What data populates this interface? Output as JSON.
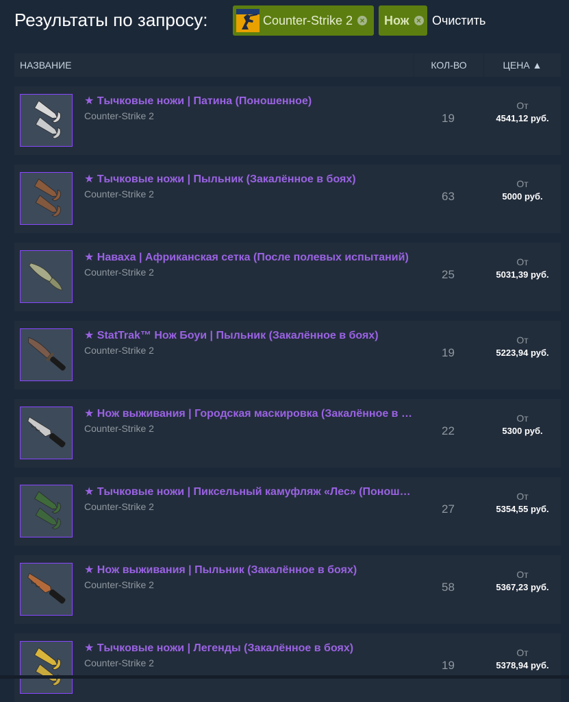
{
  "header": {
    "title": "Результаты по запросу:",
    "filters": [
      {
        "label": "Counter-Strike 2",
        "icon": "cs2-game-icon"
      },
      {
        "label": "Нож"
      }
    ],
    "clear_label": "Очистить",
    "remove_symbol": "×"
  },
  "table": {
    "columns": {
      "name": "НАЗВАНИЕ",
      "qty": "КОЛ-ВО",
      "price": "ЦЕНА ▲"
    },
    "price_prefix": "От",
    "listings": [
      {
        "name": "★ Тычковые ножи | Патина (Поношенное)",
        "game": "Counter-Strike 2",
        "qty": "19",
        "price": "4541,12 руб.",
        "blade_color": "#d8d8d8",
        "style": "push"
      },
      {
        "name": "★ Тычковые ножи | Пыльник (Закалённое в боях)",
        "game": "Counter-Strike 2",
        "qty": "63",
        "price": "5000 руб.",
        "blade_color": "#8a5a3c",
        "style": "push"
      },
      {
        "name": "★ Наваха | Африканская сетка (После полевых испытаний)",
        "game": "Counter-Strike 2",
        "qty": "25",
        "price": "5031,39 руб.",
        "blade_color": "#a6aa88",
        "style": "navaja"
      },
      {
        "name": "★ StatTrak™ Нож Боуи | Пыльник (Закалённое в боях)",
        "game": "Counter-Strike 2",
        "qty": "19",
        "price": "5223,94 руб.",
        "blade_color": "#7a5a4a",
        "style": "bowie"
      },
      {
        "name": "★ Нож выживания | Городская маскировка (Закалённое в боях)",
        "game": "Counter-Strike 2",
        "qty": "22",
        "price": "5300 руб.",
        "blade_color": "#c8c8c8",
        "style": "survival"
      },
      {
        "name": "★ Тычковые ножи | Пиксельный камуфляж «Лес» (Поношенное)",
        "game": "Counter-Strike 2",
        "qty": "27",
        "price": "5354,55 руб.",
        "blade_color": "#3f6a3a",
        "style": "push"
      },
      {
        "name": "★ Нож выживания | Пыльник (Закалённое в боях)",
        "game": "Counter-Strike 2",
        "qty": "58",
        "price": "5367,23 руб.",
        "blade_color": "#b36a3a",
        "style": "survival"
      },
      {
        "name": "★ Тычковые ножи | Легенды (Закалённое в боях)",
        "game": "Counter-Strike 2",
        "qty": "19",
        "price": "5378,94 руб.",
        "blade_color": "#d8b43a",
        "style": "push"
      }
    ]
  },
  "colors": {
    "page_bg": "#1b2838",
    "row_bg": "#222d3b",
    "filter_tag_bg": "#5c7e10",
    "item_name": "#9a63e3",
    "thumb_border": "#8847ff"
  }
}
